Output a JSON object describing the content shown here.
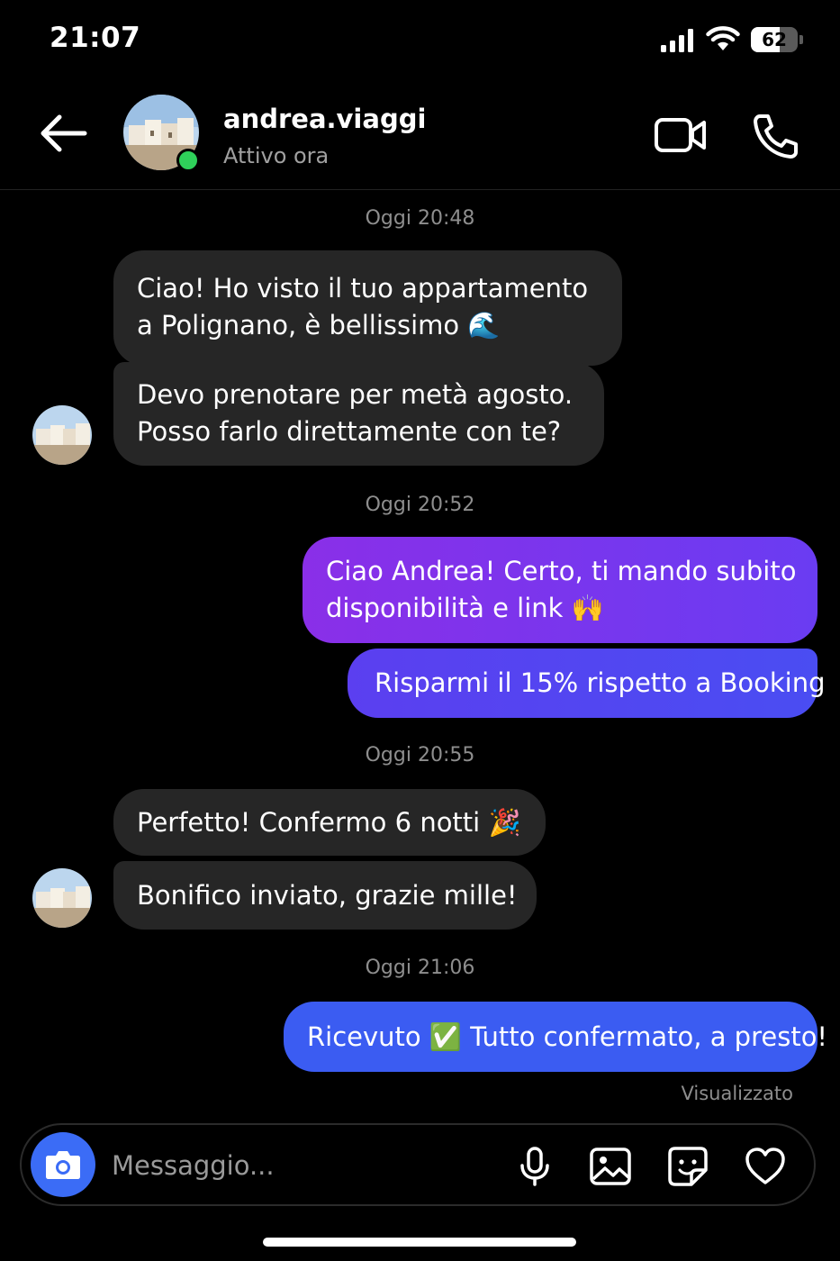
{
  "status_bar": {
    "time": "21:07",
    "battery_level": "62",
    "battery_fraction": 0.62
  },
  "header": {
    "username": "andrea.viaggi",
    "status": "Attivo ora",
    "online": true
  },
  "messages": [
    {
      "type": "timestamp",
      "text": "Oggi 20:48"
    },
    {
      "type": "incoming",
      "lines": [
        "Ciao! Ho visto il tuo appartamento",
        "a Polignano, è bellissimo 🌊"
      ]
    },
    {
      "type": "incoming",
      "lines": [
        "Devo prenotare per metà agosto.",
        "Posso farlo direttamente con te?"
      ]
    },
    {
      "type": "timestamp",
      "text": "Oggi 20:52"
    },
    {
      "type": "outgoing",
      "lines": [
        "Ciao Andrea! Certo, ti mando subito",
        "disponibilità e link 🙌"
      ]
    },
    {
      "type": "outgoing",
      "lines": [
        "Risparmi il 15% rispetto a Booking"
      ]
    },
    {
      "type": "timestamp",
      "text": "Oggi 20:55"
    },
    {
      "type": "incoming",
      "lines": [
        "Perfetto! Confermo 6 notti 🎉"
      ]
    },
    {
      "type": "incoming",
      "lines": [
        "Bonifico inviato, grazie mille!"
      ]
    },
    {
      "type": "timestamp",
      "text": "Oggi 21:06"
    },
    {
      "type": "outgoing",
      "lines": [
        "Ricevuto ✅ Tutto confermato, a presto!"
      ]
    }
  ],
  "seen_label": "Visualizzato",
  "composer": {
    "placeholder": "Messaggio...",
    "icons": [
      "camera-icon",
      "microphone-icon",
      "gallery-icon",
      "sticker-icon",
      "heart-icon"
    ]
  },
  "colors": {
    "background": "#000000",
    "incoming_bubble": "#262626",
    "outgoing_purple": "#7a35f0",
    "outgoing_blue": "#3b5cf2",
    "online_dot": "#2fd15a",
    "camera_button": "#3b6cf6"
  }
}
